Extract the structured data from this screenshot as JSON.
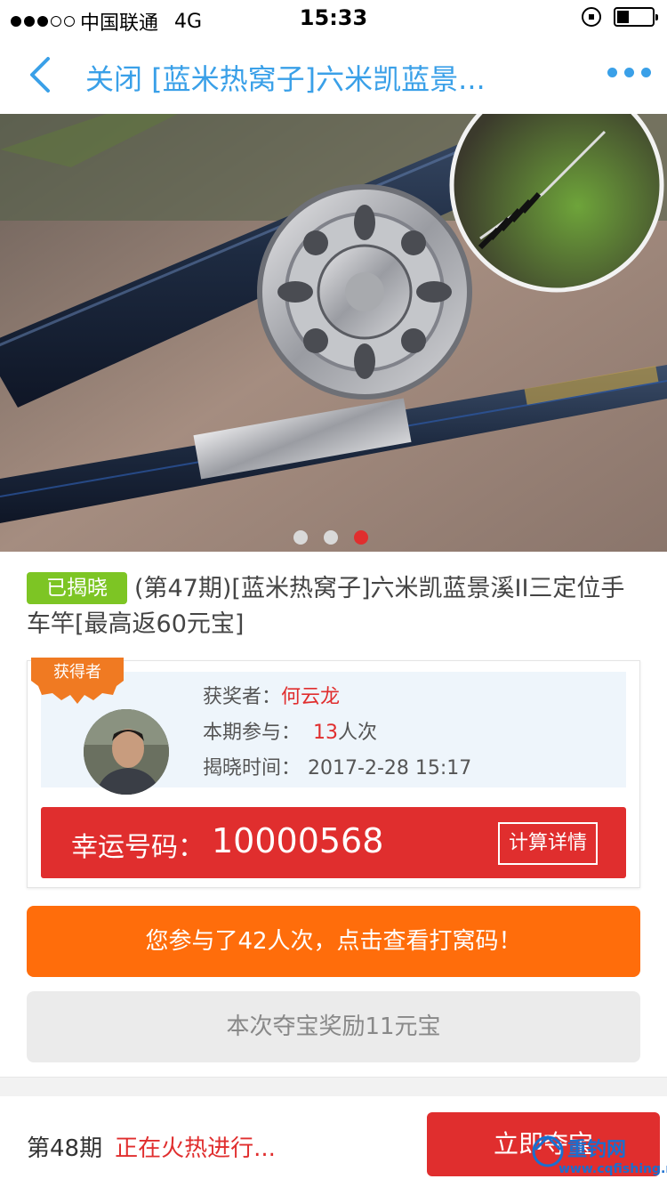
{
  "status_bar": {
    "carrier": "中国联通",
    "network": "4G",
    "time": "15:33"
  },
  "nav": {
    "title": "关闭 [蓝米热窝子]六米凯蓝景..."
  },
  "carousel": {
    "total": 3,
    "active": 3
  },
  "product": {
    "tag": "已揭晓",
    "title": "(第47期)[蓝米热窝子]六米凯蓝景溪II三定位手车竿[最高返60元宝]"
  },
  "winner": {
    "badge": "获得者",
    "winner_label": "获奖者：",
    "winner_name": "何云龙",
    "participation_label": "本期参与：",
    "participation_count": "13",
    "participation_unit": "人次",
    "reveal_label": "揭晓时间：",
    "reveal_time": "2017-2-28 15:17"
  },
  "lucky": {
    "label": "幸运号码：",
    "code": "10000568",
    "detail_button": "计算详情"
  },
  "actions": {
    "participated": "您参与了42人次，点击查看打窝码！",
    "reward": "本次夺宝奖励11元宝"
  },
  "bottom": {
    "period": "第48期",
    "status": "正在火热进行...",
    "join_button": "立即夺宝"
  },
  "watermark": {
    "name": "重钓网",
    "url": "www.cqfishing.net"
  },
  "colors": {
    "accent_blue": "#3aa0e8",
    "red": "#e02e2e",
    "orange": "#ff6d0b",
    "green": "#7dc524"
  }
}
